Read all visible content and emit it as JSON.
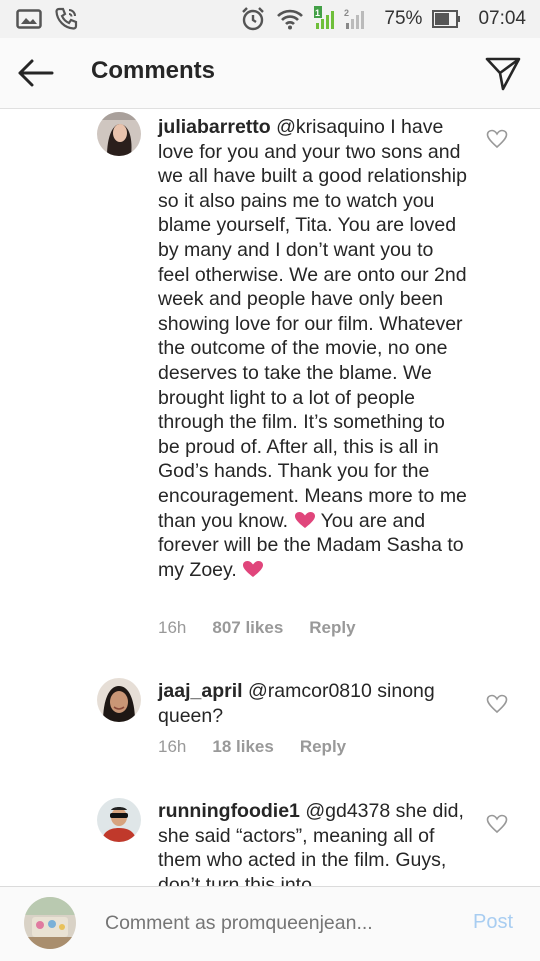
{
  "status_bar": {
    "battery": "75%",
    "time": "07:04",
    "icons": [
      "gallery-icon",
      "phone-icon",
      "alarm-icon",
      "wifi-icon",
      "signal-icon",
      "battery-icon"
    ]
  },
  "header": {
    "title": "Comments",
    "back_icon": "arrow-left-icon",
    "share_icon": "paper-plane-icon"
  },
  "comments": [
    {
      "username": "juliabarretto",
      "mention": "@krisaquino",
      "text_part1": "I have love for you and your two sons and we all have built a good relationship so it also pains me to watch you blame yourself, Tita. You are loved by many and I don’t want you to feel otherwise. We are onto our 2nd week and people have only been showing love for our film. Whatever the outcome of the movie, no one deserves to take the blame. We brought light to a lot of people through the film. It’s something to be proud of. After all, this is all in God’s hands. Thank you for the encouragement. Means more to me than you know.",
      "text_part2": "You are and forever will be the Madam Sasha to my Zoey.",
      "time": "16h",
      "likes": "807 likes",
      "reply": "Reply"
    },
    {
      "username": "jaaj_april",
      "mention": "@ramcor0810",
      "text_part1": "sinong queen?",
      "time": "16h",
      "likes": "18 likes",
      "reply": "Reply"
    },
    {
      "username": "runningfoodie1",
      "mention": "@gd4378",
      "text_part1": "she did, she said “actors”, meaning all of them who acted in the film. Guys, don’t turn this into"
    }
  ],
  "composer": {
    "placeholder": "Comment as promqueenjean...",
    "post_label": "Post"
  },
  "colors": {
    "accent_blue_disabled": "#a8cdf1",
    "heart_pink": "#e0457b"
  }
}
